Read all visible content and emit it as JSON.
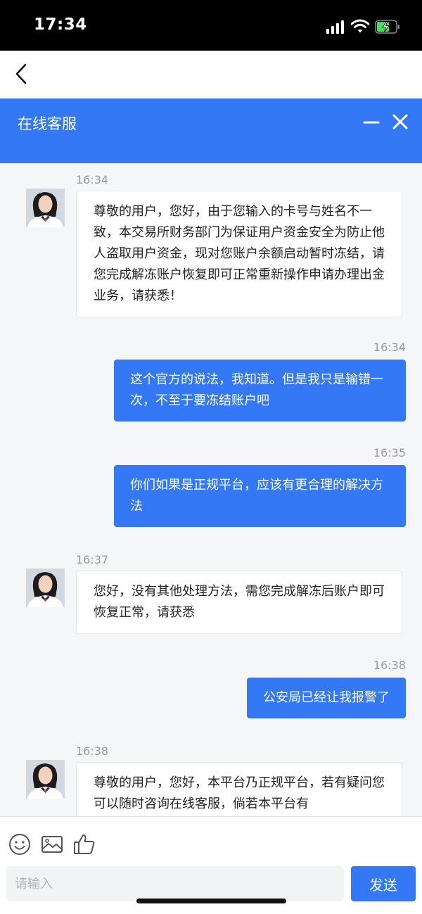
{
  "status_bar": {
    "time": "17:34"
  },
  "chat": {
    "title": "在线客服",
    "messages": [
      {
        "from": "agent",
        "time": "16:34",
        "text": "尊敬的用户，您好，由于您输入的卡号与姓名不一致，本交易所财务部门为保证用户资金安全为防止他人盗取用户资金，现对您账户余额启动暂时冻结，请您完成解冻账户恢复即可正常重新操作申请办理出金业务，请获悉！"
      },
      {
        "from": "user",
        "time": "16:34",
        "text": "这个官方的说法，我知道。但是我只是输错一次，不至于要冻结账户吧"
      },
      {
        "from": "user",
        "time": "16:35",
        "text": "你们如果是正规平台，应该有更合理的解决方法"
      },
      {
        "from": "agent",
        "time": "16:37",
        "text": "您好，没有其他处理方法，需您完成解冻后账户即可恢复正常，请获悉"
      },
      {
        "from": "user",
        "time": "16:38",
        "text": "公安局已经让我报警了"
      },
      {
        "from": "agent",
        "time": "16:38",
        "text": "尊敬的用户，您好，本平台乃正规平台，若有疑问您可以随时咨询在线客服，倘若本平台有"
      }
    ]
  },
  "composer": {
    "placeholder": "请输入",
    "send_label": "发送"
  },
  "icons": [
    "back-icon",
    "minimize-icon",
    "close-icon",
    "emoji-icon",
    "image-icon",
    "thumbs-up-icon"
  ],
  "colors": {
    "accent": "#3478f6",
    "background": "#f5f6f8"
  }
}
